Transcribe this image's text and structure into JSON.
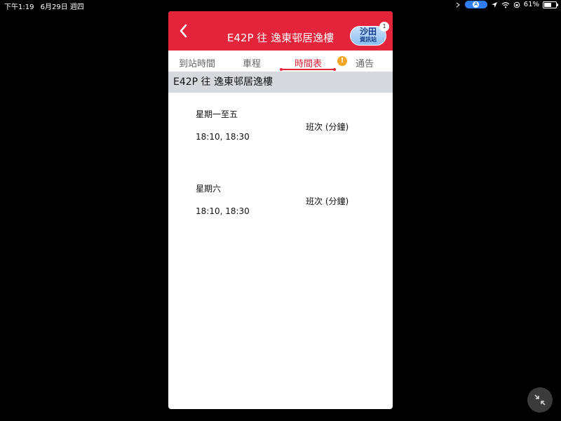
{
  "status_bar": {
    "time": "下午1:19",
    "date": "6月29日 週四",
    "battery_percent": "61%",
    "battery_level": 0.61
  },
  "header": {
    "title": "E42P 往 逸東邨居逸樓",
    "logo_main": "沙田",
    "logo_sub": "資訊站",
    "logo_count": "1"
  },
  "tabs": [
    {
      "label": "到站時間",
      "active": false
    },
    {
      "label": "車程",
      "active": false
    },
    {
      "label": "時間表",
      "active": true
    },
    {
      "label": "通告",
      "active": false
    }
  ],
  "route_bar": "E42P 往 逸東邨居逸樓",
  "schedules": [
    {
      "day": "星期一至五",
      "freq_label": "班次 (分鐘)",
      "times": "18:10, 18:30"
    },
    {
      "day": "星期六",
      "freq_label": "班次 (分鐘)",
      "times": "18:10, 18:30"
    }
  ],
  "colors": {
    "accent": "#e3243a",
    "route_bar_bg": "#d6dadd",
    "alert": "#f6a623"
  }
}
